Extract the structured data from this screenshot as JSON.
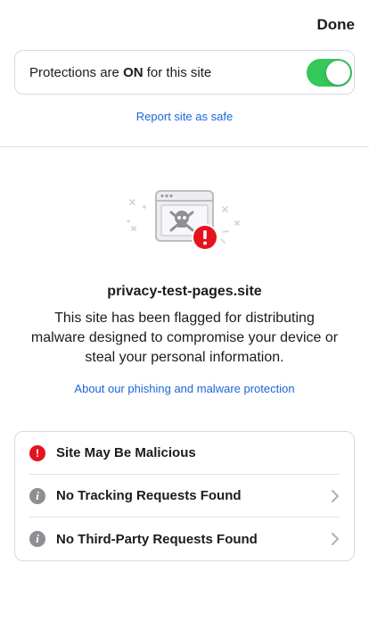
{
  "header": {
    "done_label": "Done"
  },
  "protections": {
    "text_prefix": "Protections are ",
    "text_status": "ON",
    "text_suffix": " for this site",
    "toggle_on": true,
    "toggle_color": "#34c759"
  },
  "report_link": "Report site as safe",
  "hero": {
    "icon": "browser-skull-warning-icon",
    "domain": "privacy-test-pages.site",
    "message": "This site has been flagged for distributing malware designed to compromise your device or steal your personal information.",
    "about_link": "About our phishing and malware protection"
  },
  "status_rows": [
    {
      "label": "Site May Be Malicious",
      "icon": "warning-icon",
      "color": "#e5131f",
      "has_chevron": false
    },
    {
      "label": "No Tracking Requests Found",
      "icon": "info-icon",
      "color": "#8e8e93",
      "has_chevron": true
    },
    {
      "label": "No Third-Party Requests Found",
      "icon": "info-icon",
      "color": "#8e8e93",
      "has_chevron": true
    }
  ],
  "colors": {
    "link": "#1a66d9",
    "danger": "#e5131f"
  }
}
